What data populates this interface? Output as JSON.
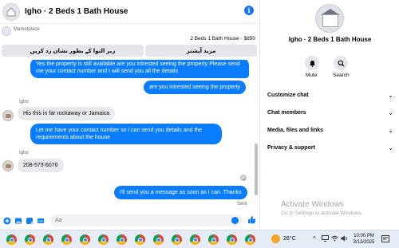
{
  "header": {
    "title": "Igho · 2 Beds 1 Bath House",
    "info_icon": "info-icon"
  },
  "marketplace": {
    "label": "Marketplace",
    "listing": "2 Beds 1 Bath House · $850",
    "buttons": [
      "زبر التوا کے بطور نشان زد کریں",
      "مزید آپشنز"
    ]
  },
  "messages": [
    {
      "from": "me",
      "text": "Yes the property is still available are you intrested seeing the property Please send me your contact number and I will send you all the details"
    },
    {
      "from": "me",
      "text": "are you intrested seeing the property"
    },
    {
      "from": "Igho",
      "sender": "Igho",
      "text": "His this in far rockaway or Jamaica"
    },
    {
      "from": "me",
      "text": "Let me have your contact number so i can send you details and the requirements about the house"
    },
    {
      "from": "Igho",
      "sender": "Igho",
      "text": "208-573-6076"
    },
    {
      "from": "me",
      "text": "I'll send you a message as soon as I can. Thanks"
    }
  ],
  "status": {
    "sent": "Sent"
  },
  "composer": {
    "placeholder": "Aa"
  },
  "info_panel": {
    "name": "Igho · 2 Beds 1 Bath House",
    "mute_label": "Mute",
    "search_label": "Search",
    "sections": [
      "Customize chat",
      "Chat members",
      "Media, files and links",
      "Privacy & support"
    ],
    "activate_title": "Activate Windows",
    "activate_sub": "Go to Settings to activate Windows."
  },
  "taskbar": {
    "app_count": 14,
    "temperature": "26°C",
    "time": "10:00 PM",
    "date": "3/13/2025"
  },
  "colors": {
    "accent": "#0a7cff",
    "bubble_in": "#e9eaed"
  }
}
